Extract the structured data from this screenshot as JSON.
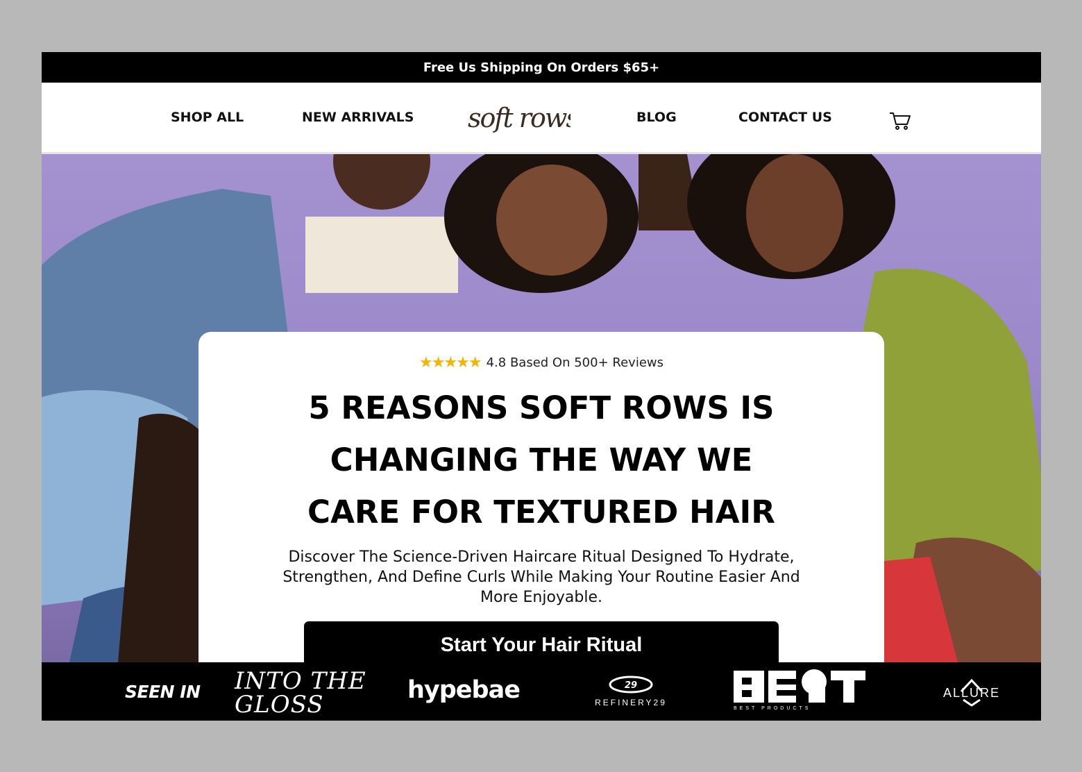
{
  "announcement": "Free Us Shipping On Orders $65+",
  "nav": {
    "left": [
      "SHOP ALL",
      "NEW ARRIVALS"
    ],
    "logo": "soft rows",
    "right": [
      "BLOG",
      "CONTACT US"
    ],
    "cart_icon": "cart-icon"
  },
  "hero": {
    "rating": {
      "stars": "★★★★★",
      "score": 4.8,
      "text": "4.8 Based On 500+ Reviews"
    },
    "headline": "5 REASONS SOFT ROWS IS CHANGING THE WAY WE CARE FOR TEXTURED HAIR",
    "subhead": "Discover The Science-Driven Haircare Ritual Designed To Hydrate, Strengthen, And Define Curls While Making Your Routine Easier And More Enjoyable.",
    "cta": "Start Your Hair Ritual",
    "background_color": "#a492d0"
  },
  "press": {
    "label": "SEEN IN",
    "logos": [
      "INTO THE GLOSS",
      "hypebae",
      "REFINERY29",
      "BEST PRODUCTS",
      "ALLURE"
    ]
  },
  "colors": {
    "bar": "#000000",
    "star": "#f4b400",
    "logo": "#3b2a22"
  }
}
